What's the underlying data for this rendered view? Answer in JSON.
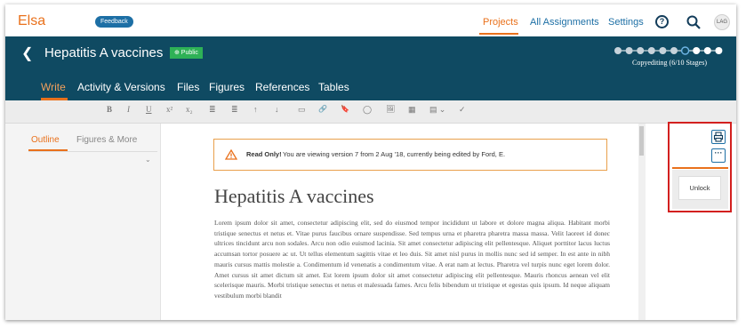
{
  "app": {
    "logo": "Elsa",
    "feedback_label": "Feedback"
  },
  "topnav": {
    "items": [
      "Projects",
      "All Assignments",
      "Settings"
    ],
    "active": "Projects",
    "avatar_initials": "LAG"
  },
  "header": {
    "title": "Hepatitis A vaccines",
    "public_badge": "⊕ Public",
    "stages_total": 10,
    "stages_done": 6,
    "stage_label": "Copyediting (6/10 Stages)",
    "tabs": [
      "Write",
      "Activity & Versions",
      "Files",
      "Figures",
      "References",
      "Tables"
    ],
    "active_tab": "Write"
  },
  "toolbar": {
    "buttons": [
      "B",
      "I",
      "U",
      "x²",
      "x₂",
      "≣",
      "≣",
      "↑",
      "↓",
      "▭",
      "🔗",
      "🔖",
      "◯",
      "🖼",
      "▦",
      "▤ ⌄",
      "✓"
    ]
  },
  "left_panel": {
    "tabs": [
      "Outline",
      "Figures & More"
    ],
    "active_tab": "Outline",
    "collapse_glyph": "«"
  },
  "notice": {
    "strong": "Read Only!",
    "text": "You are viewing version 7 from 2 Aug '18, currently being edited by Ford, E."
  },
  "document": {
    "heading": "Hepatitis A vaccines",
    "body": "Lorem ipsum dolor sit amet, consectetur adipiscing elit, sed do eiusmod tempor incididunt ut labore et dolore magna aliqua. Habitant morbi tristique senectus et netus et. Vitae purus faucibus ornare suspendisse. Sed tempus urna et pharetra pharetra massa massa. Velit laoreet id donec ultrices tincidunt arcu non sodales. Arcu non odio euismod lacinia. Sit amet consectetur adipiscing elit pellentesque. Aliquet porttitor lacus luctus accumsan tortor posuere ac ut. Ut tellus elementum sagittis vitae et leo duis. Sit amet nisl purus in mollis nunc sed id semper. In est ante in nibh mauris cursus mattis molestie a. Condimentum id venenatis a condimentum vitae. A erat nam at lectus. Pharetra vel turpis nunc eget lorem dolor. Amet cursus sit amet dictum sit amet. Est lorem ipsum dolor sit amet consectetur adipiscing elit pellentesque. Mauris rhoncus aenean vel elit scelerisque mauris. Morbi tristique senectus et netus et malesuada fames. Arcu felis bibendum ut tristique et egestas quis ipsum. Id neque aliquam vestibulum morbi blandit"
  },
  "right_panel": {
    "more_glyph": "···",
    "unlock_label": "Unlock"
  },
  "colors": {
    "accent": "#e9711c",
    "header_bg": "#0f4a62",
    "link": "#1d6fa5",
    "public": "#2eb156",
    "highlight": "#d3201f"
  },
  "icons": [
    "back-icon",
    "help-icon",
    "search-icon",
    "warning-icon",
    "print-icon",
    "more-icon",
    "collapse-icon",
    "chevron-down-icon"
  ]
}
